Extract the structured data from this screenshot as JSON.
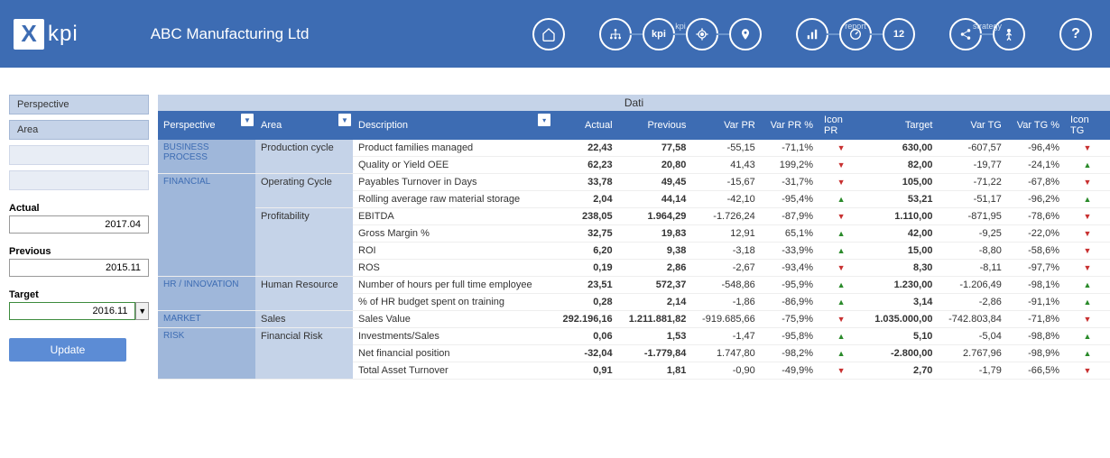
{
  "header": {
    "logo_text": "kpi",
    "company": "ABC Manufacturing Ltd",
    "nav_labels": {
      "kpi": "kpi",
      "report": "report",
      "strategy": "strategy"
    }
  },
  "sidebar": {
    "perspective_label": "Perspective",
    "area_label": "Area",
    "actual_label": "Actual",
    "actual_value": "2017.04",
    "previous_label": "Previous",
    "previous_value": "2015.11",
    "target_label": "Target",
    "target_value": "2016.11",
    "update_label": "Update"
  },
  "table": {
    "title": "Dati",
    "headers": {
      "perspective": "Perspective",
      "area": "Area",
      "description": "Description",
      "actual": "Actual",
      "previous": "Previous",
      "var_pr": "Var PR",
      "var_pr_pct": "Var PR %",
      "icon_pr": "Icon PR",
      "target": "Target",
      "var_tg": "Var TG",
      "var_tg_pct": "Var TG %",
      "icon_tg": "Icon TG"
    },
    "sections": [
      {
        "perspective": "BUSINESS PROCESS",
        "areas": [
          {
            "area": "Production cycle",
            "rows": [
              {
                "desc": "Product families managed",
                "actual": "22,43",
                "previous": "77,58",
                "var_pr": "-55,15",
                "var_pr_pct": "-71,1%",
                "icon_pr": "down",
                "target": "630,00",
                "var_tg": "-607,57",
                "var_tg_pct": "-96,4%",
                "icon_tg": "down"
              },
              {
                "desc": "Quality or Yield OEE",
                "actual": "62,23",
                "previous": "20,80",
                "var_pr": "41,43",
                "var_pr_pct": "199,2%",
                "icon_pr": "down",
                "target": "82,00",
                "var_tg": "-19,77",
                "var_tg_pct": "-24,1%",
                "icon_tg": "up"
              }
            ]
          }
        ]
      },
      {
        "perspective": "FINANCIAL",
        "areas": [
          {
            "area": "Operating Cycle",
            "rows": [
              {
                "desc": "Payables Turnover in Days",
                "actual": "33,78",
                "previous": "49,45",
                "var_pr": "-15,67",
                "var_pr_pct": "-31,7%",
                "icon_pr": "down",
                "target": "105,00",
                "var_tg": "-71,22",
                "var_tg_pct": "-67,8%",
                "icon_tg": "down"
              },
              {
                "desc": "Rolling average raw material storage",
                "actual": "2,04",
                "previous": "44,14",
                "var_pr": "-42,10",
                "var_pr_pct": "-95,4%",
                "icon_pr": "up",
                "target": "53,21",
                "var_tg": "-51,17",
                "var_tg_pct": "-96,2%",
                "icon_tg": "up"
              }
            ]
          },
          {
            "area": "Profitability",
            "rows": [
              {
                "desc": "EBITDA",
                "actual": "238,05",
                "previous": "1.964,29",
                "var_pr": "-1.726,24",
                "var_pr_pct": "-87,9%",
                "icon_pr": "down",
                "target": "1.110,00",
                "var_tg": "-871,95",
                "var_tg_pct": "-78,6%",
                "icon_tg": "down"
              },
              {
                "desc": "Gross Margin %",
                "actual": "32,75",
                "previous": "19,83",
                "var_pr": "12,91",
                "var_pr_pct": "65,1%",
                "icon_pr": "up",
                "target": "42,00",
                "var_tg": "-9,25",
                "var_tg_pct": "-22,0%",
                "icon_tg": "down"
              },
              {
                "desc": "ROI",
                "actual": "6,20",
                "previous": "9,38",
                "var_pr": "-3,18",
                "var_pr_pct": "-33,9%",
                "icon_pr": "up",
                "target": "15,00",
                "var_tg": "-8,80",
                "var_tg_pct": "-58,6%",
                "icon_tg": "down"
              },
              {
                "desc": "ROS",
                "actual": "0,19",
                "previous": "2,86",
                "var_pr": "-2,67",
                "var_pr_pct": "-93,4%",
                "icon_pr": "down",
                "target": "8,30",
                "var_tg": "-8,11",
                "var_tg_pct": "-97,7%",
                "icon_tg": "down"
              }
            ]
          }
        ]
      },
      {
        "perspective": "HR / INNOVATION",
        "areas": [
          {
            "area": "Human Resource",
            "rows": [
              {
                "desc": "Number of hours per full time employee",
                "actual": "23,51",
                "previous": "572,37",
                "var_pr": "-548,86",
                "var_pr_pct": "-95,9%",
                "icon_pr": "up",
                "target": "1.230,00",
                "var_tg": "-1.206,49",
                "var_tg_pct": "-98,1%",
                "icon_tg": "up"
              },
              {
                "desc": "% of HR budget spent on training",
                "actual": "0,28",
                "previous": "2,14",
                "var_pr": "-1,86",
                "var_pr_pct": "-86,9%",
                "icon_pr": "up",
                "target": "3,14",
                "var_tg": "-2,86",
                "var_tg_pct": "-91,1%",
                "icon_tg": "up"
              }
            ]
          }
        ]
      },
      {
        "perspective": "MARKET",
        "areas": [
          {
            "area": "Sales",
            "rows": [
              {
                "desc": "Sales Value",
                "actual": "292.196,16",
                "previous": "1.211.881,82",
                "var_pr": "-919.685,66",
                "var_pr_pct": "-75,9%",
                "icon_pr": "down",
                "target": "1.035.000,00",
                "var_tg": "-742.803,84",
                "var_tg_pct": "-71,8%",
                "icon_tg": "down"
              }
            ]
          }
        ]
      },
      {
        "perspective": "RISK",
        "areas": [
          {
            "area": "Financial Risk",
            "rows": [
              {
                "desc": "Investments/Sales",
                "actual": "0,06",
                "previous": "1,53",
                "var_pr": "-1,47",
                "var_pr_pct": "-95,8%",
                "icon_pr": "up",
                "target": "5,10",
                "var_tg": "-5,04",
                "var_tg_pct": "-98,8%",
                "icon_tg": "up"
              },
              {
                "desc": "Net financial position",
                "actual": "-32,04",
                "previous": "-1.779,84",
                "var_pr": "1.747,80",
                "var_pr_pct": "-98,2%",
                "icon_pr": "up",
                "target": "-2.800,00",
                "var_tg": "2.767,96",
                "var_tg_pct": "-98,9%",
                "icon_tg": "up"
              },
              {
                "desc": "Total Asset Turnover",
                "actual": "0,91",
                "previous": "1,81",
                "var_pr": "-0,90",
                "var_pr_pct": "-49,9%",
                "icon_pr": "down",
                "target": "2,70",
                "var_tg": "-1,79",
                "var_tg_pct": "-66,5%",
                "icon_tg": "down"
              }
            ]
          }
        ]
      }
    ]
  }
}
